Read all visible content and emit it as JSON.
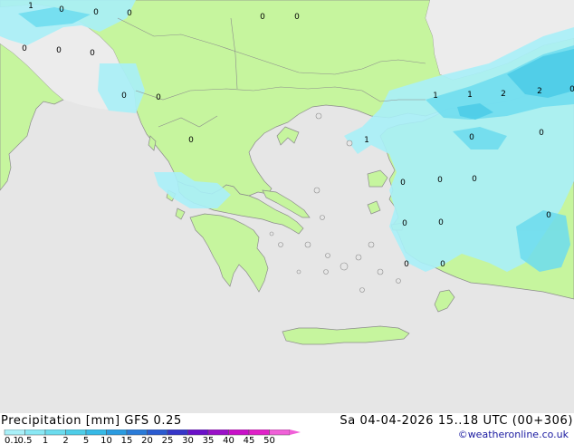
{
  "title": {
    "left": "Precipitation [mm]  GFS 0.25",
    "right": "Sa 04-04-2026 15..18 UTC (00+306)"
  },
  "copyright": "©weatheronline.co.uk",
  "legend": {
    "labels": [
      "0.1",
      "0.5",
      "1",
      "2",
      "5",
      "10",
      "15",
      "20",
      "25",
      "30",
      "35",
      "40",
      "45",
      "50"
    ],
    "colors": [
      "#a9f0f8",
      "#8ae8f4",
      "#6cdcee",
      "#4ecde8",
      "#36b9e6",
      "#2a9be0",
      "#2a7bd8",
      "#2a5bd0",
      "#3535c8",
      "#6a10c8",
      "#9a10c8",
      "#c810c8",
      "#e020c8",
      "#f060d8"
    ]
  },
  "colors": {
    "sea": "#e6e6e6",
    "land": "#c6f59e",
    "nodata": "#ececec",
    "precip_light": "#a9f0f8",
    "precip_medium": "#6cdcee",
    "precip_heavy": "#4ecde8",
    "border": "#8c8c8c"
  },
  "markers": [
    {
      "name": "marker-1",
      "value": "1"
    },
    {
      "name": "marker-2",
      "value": "0"
    },
    {
      "name": "marker-3",
      "value": "0"
    },
    {
      "name": "marker-4",
      "value": "0"
    },
    {
      "name": "marker-5",
      "value": "0"
    },
    {
      "name": "marker-6",
      "value": "0"
    },
    {
      "name": "marker-7",
      "value": "0"
    },
    {
      "name": "marker-8",
      "value": "0"
    },
    {
      "name": "marker-9",
      "value": "0"
    },
    {
      "name": "marker-10",
      "value": "0"
    },
    {
      "name": "marker-11",
      "value": "0"
    },
    {
      "name": "marker-12",
      "value": "0"
    },
    {
      "name": "marker-13",
      "value": "1"
    },
    {
      "name": "marker-14",
      "value": "1"
    },
    {
      "name": "marker-15",
      "value": "2"
    },
    {
      "name": "marker-16",
      "value": "2"
    },
    {
      "name": "marker-17",
      "value": "0"
    },
    {
      "name": "marker-18",
      "value": "1"
    },
    {
      "name": "marker-19",
      "value": "0"
    },
    {
      "name": "marker-20",
      "value": "0"
    },
    {
      "name": "marker-21",
      "value": "0"
    },
    {
      "name": "marker-22",
      "value": "0"
    },
    {
      "name": "marker-23",
      "value": "0"
    },
    {
      "name": "marker-24",
      "value": "0"
    },
    {
      "name": "marker-25",
      "value": "0"
    },
    {
      "name": "marker-26",
      "value": "0"
    },
    {
      "name": "marker-27",
      "value": "0"
    },
    {
      "name": "marker-28",
      "value": "0"
    }
  ]
}
